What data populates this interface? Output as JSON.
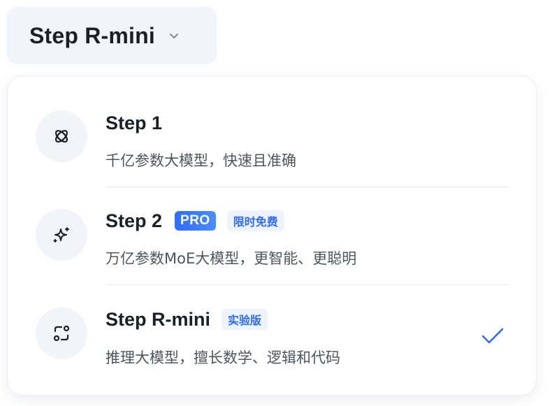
{
  "trigger": {
    "current_model": "Step R-mini",
    "chevron_icon": "chevron-down-icon"
  },
  "options": [
    {
      "title": "Step 1",
      "description": "千亿参数大模型，快速且准确",
      "icon": "orbit-icon",
      "selected": false
    },
    {
      "title": "Step 2",
      "badge_pro": "PRO",
      "badge_tag": "限时免费",
      "description": "万亿参数MoE大模型，更智能、更聪明",
      "icon": "sparkle-icon",
      "selected": false
    },
    {
      "title": "Step R-mini",
      "badge_tag": "实验版",
      "description": "推理大模型，擅长数学、逻辑和代码",
      "icon": "reasoning-icon",
      "selected": true
    }
  ],
  "colors": {
    "accent": "#2f6bff",
    "trigger_bg": "#f2f4f9",
    "text_primary": "#1c1f26",
    "text_secondary": "#50545e"
  }
}
